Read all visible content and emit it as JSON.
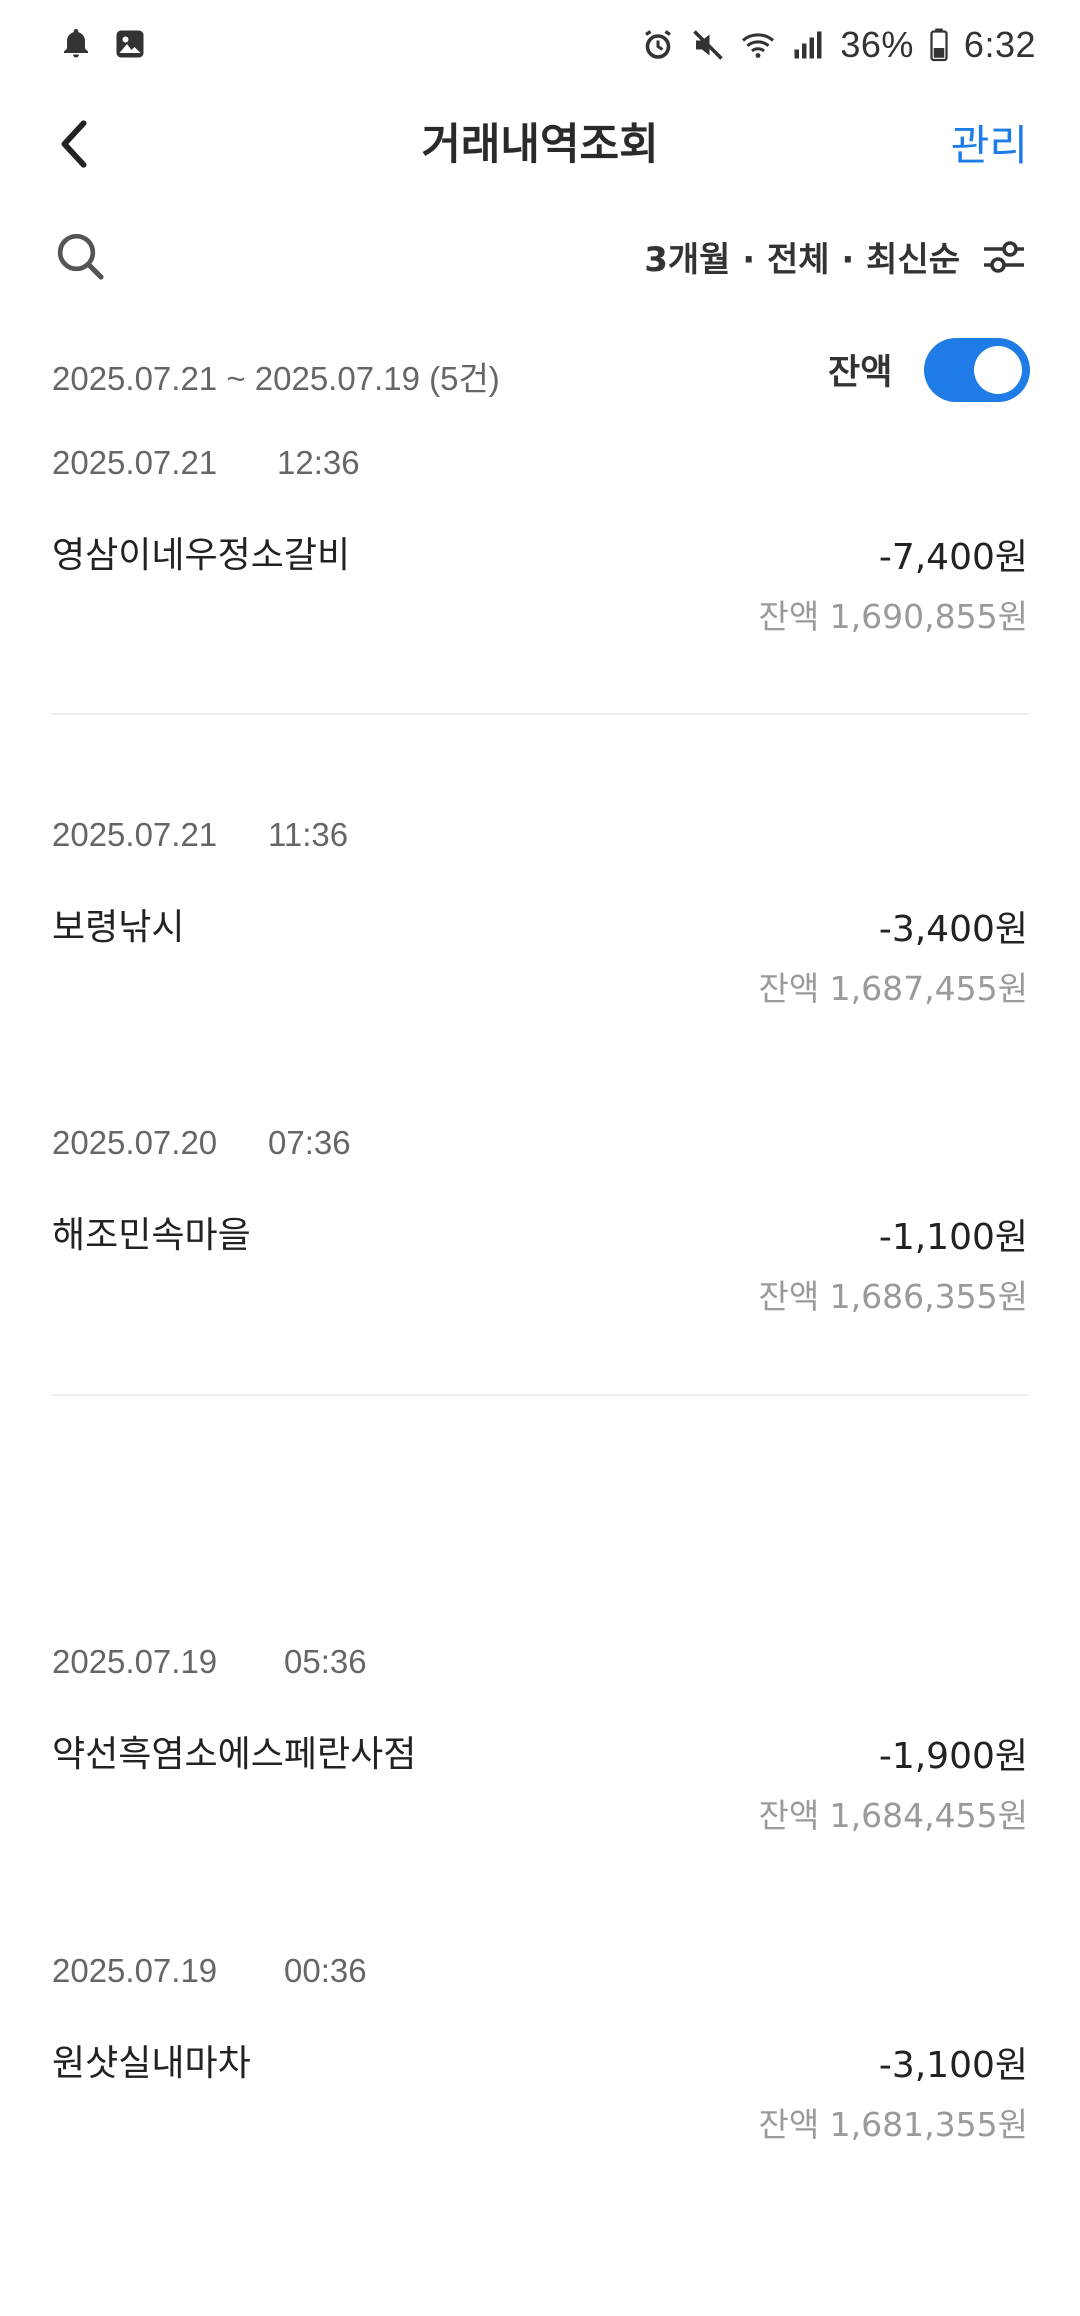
{
  "status_bar": {
    "battery": "36%",
    "time": "6:32",
    "left_icons": [
      "bell-icon",
      "image-icon"
    ],
    "right_icons": [
      "alarm-icon",
      "mute-icon",
      "wifi-icon",
      "signal-icon",
      "battery-icon"
    ]
  },
  "header": {
    "title": "거래내역조회",
    "manage_label": "관리",
    "accent_color": "#1f7ce6"
  },
  "filter": {
    "label": "3개월 · 전체 · 최신순"
  },
  "summary": {
    "range": "2025.07.21 ~ 2025.07.19 (5건)",
    "balance_toggle_label": "잔액",
    "balance_toggle_on": true
  },
  "transactions": [
    {
      "date": "2025.07.21",
      "time": "12:36",
      "merchant": "영삼이네우정소갈비",
      "amount": "-7,400원",
      "balance": "잔액 1,690,855원"
    },
    {
      "date": "2025.07.21",
      "time": "11:36",
      "merchant": "보령낚시",
      "amount": "-3,400원",
      "balance": "잔액 1,687,455원"
    },
    {
      "date": "2025.07.20",
      "time": "07:36",
      "merchant": "해조민속마을",
      "amount": "-1,100원",
      "balance": "잔액 1,686,355원"
    },
    {
      "date": "2025.07.19",
      "time": "05:36",
      "merchant": "약선흑염소에스페란사점",
      "amount": "-1,900원",
      "balance": "잔액 1,684,455원"
    },
    {
      "date": "2025.07.19",
      "time": "00:36",
      "merchant": "원샷실내마차",
      "amount": "-3,100원",
      "balance": "잔액 1,681,355원"
    }
  ]
}
